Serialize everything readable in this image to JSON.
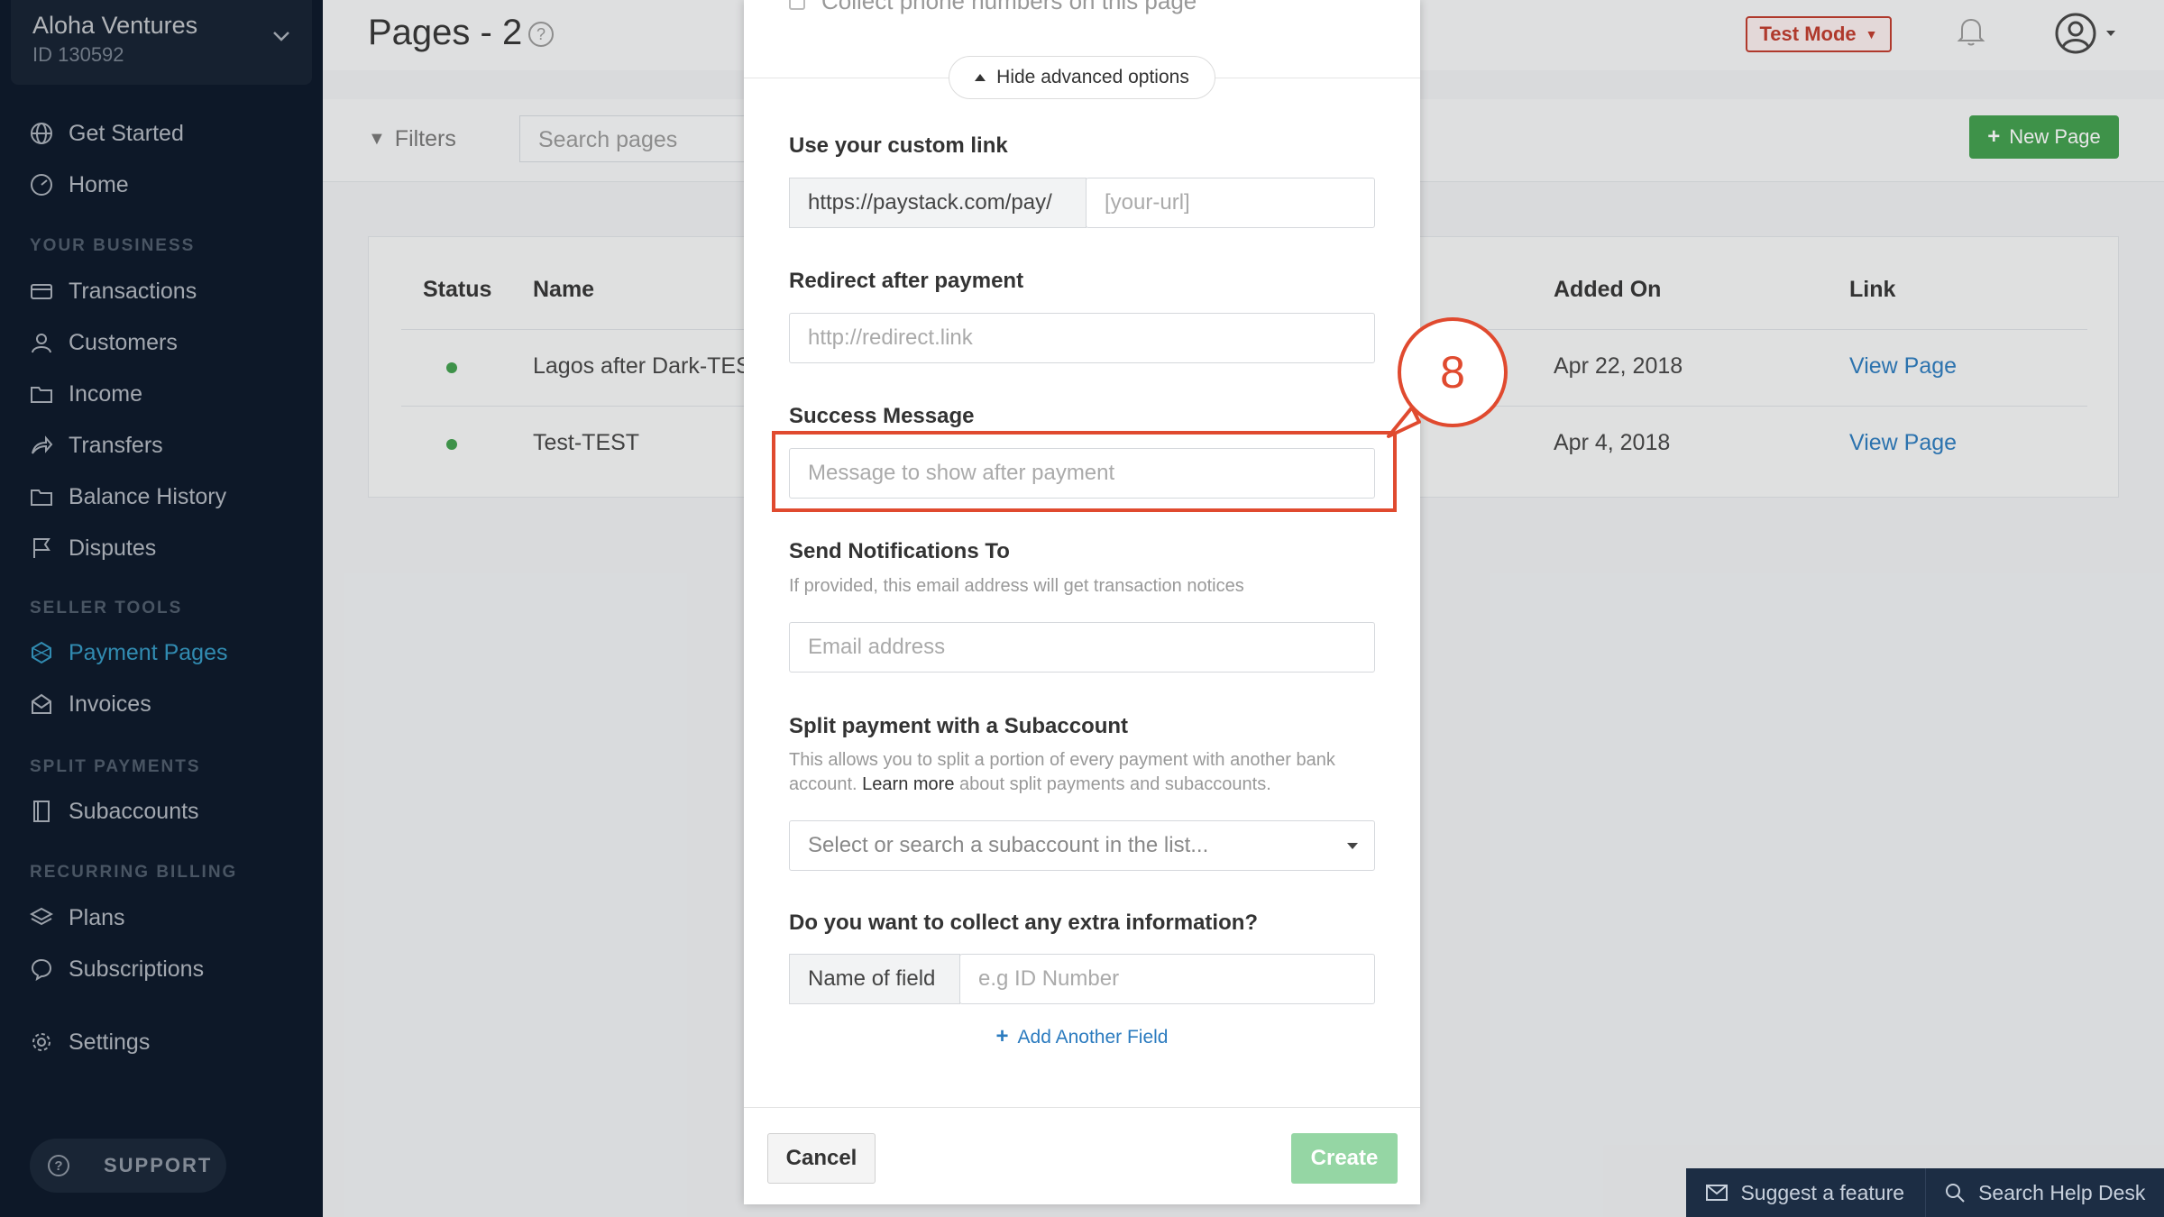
{
  "sidebar": {
    "business_name": "Aloha Ventures",
    "business_id": "ID 130592",
    "items": [
      {
        "label": "Get Started",
        "icon": "globe-icon"
      },
      {
        "label": "Home",
        "icon": "dashboard-icon"
      },
      {
        "label": "Transactions",
        "icon": "card-icon"
      },
      {
        "label": "Customers",
        "icon": "user-icon"
      },
      {
        "label": "Income",
        "icon": "folder-icon"
      },
      {
        "label": "Transfers",
        "icon": "share-icon"
      },
      {
        "label": "Balance History",
        "icon": "folder-icon"
      },
      {
        "label": "Disputes",
        "icon": "flag-icon"
      },
      {
        "label": "Payment Pages",
        "icon": "network-icon"
      },
      {
        "label": "Invoices",
        "icon": "invoice-icon"
      },
      {
        "label": "Subaccounts",
        "icon": "book-icon"
      },
      {
        "label": "Plans",
        "icon": "layers-icon"
      },
      {
        "label": "Subscriptions",
        "icon": "chat-icon"
      },
      {
        "label": "Settings",
        "icon": "gear-icon"
      }
    ],
    "headings": {
      "business": "YOUR BUSINESS",
      "seller": "SELLER TOOLS",
      "split": "SPLIT PAYMENTS",
      "recurring": "RECURRING BILLING"
    },
    "support_label": "SUPPORT",
    "active_item": "Payment Pages"
  },
  "header": {
    "title": "Pages - 2",
    "test_mode_label": "Test Mode"
  },
  "toolbar": {
    "filters_label": "Filters",
    "search_placeholder": "Search pages",
    "new_page_label": "New Page"
  },
  "table": {
    "columns": {
      "status": "Status",
      "name": "Name",
      "added_on": "Added On",
      "link": "Link"
    },
    "rows": [
      {
        "name": "Lagos after Dark-TEST",
        "added_on": "Apr 22, 2018",
        "link": "View Page"
      },
      {
        "name": "Test-TEST",
        "added_on": "Apr 4, 2018",
        "link": "View Page"
      }
    ]
  },
  "modal": {
    "cut_text": "Collect phone numbers on this page",
    "advanced_toggle": "Hide advanced options",
    "custom_link": {
      "label": "Use your custom link",
      "prefix": "https://paystack.com/pay/",
      "placeholder": "[your-url]"
    },
    "redirect": {
      "label": "Redirect after payment",
      "placeholder": "http://redirect.link"
    },
    "success": {
      "label": "Success Message",
      "placeholder": "Message to show after payment"
    },
    "notify": {
      "label": "Send Notifications To",
      "help": "If provided, this email address will get transaction notices",
      "placeholder": "Email address"
    },
    "split": {
      "label": "Split payment with a Subaccount",
      "help_before": "This allows you to split a portion of every payment with another bank account. ",
      "help_link": "Learn more",
      "help_after": " about split payments and subaccounts.",
      "placeholder": "Select or search a subaccount in the list..."
    },
    "extra": {
      "label": "Do you want to collect any extra information?",
      "addon": "Name of field",
      "placeholder": "e.g ID Number"
    },
    "add_field_label": "Add Another Field",
    "cancel_label": "Cancel",
    "create_label": "Create"
  },
  "annotation": {
    "step_number": "8",
    "color": "#e04a2f"
  },
  "helpbar": {
    "suggest_label": "Suggest a feature",
    "search_label": "Search Help Desk"
  },
  "colors": {
    "sidebar_bg": "#0b1a2e",
    "accent": "#3bb3e6",
    "primary_green": "#3f9f4c",
    "link": "#2b7bbf"
  }
}
